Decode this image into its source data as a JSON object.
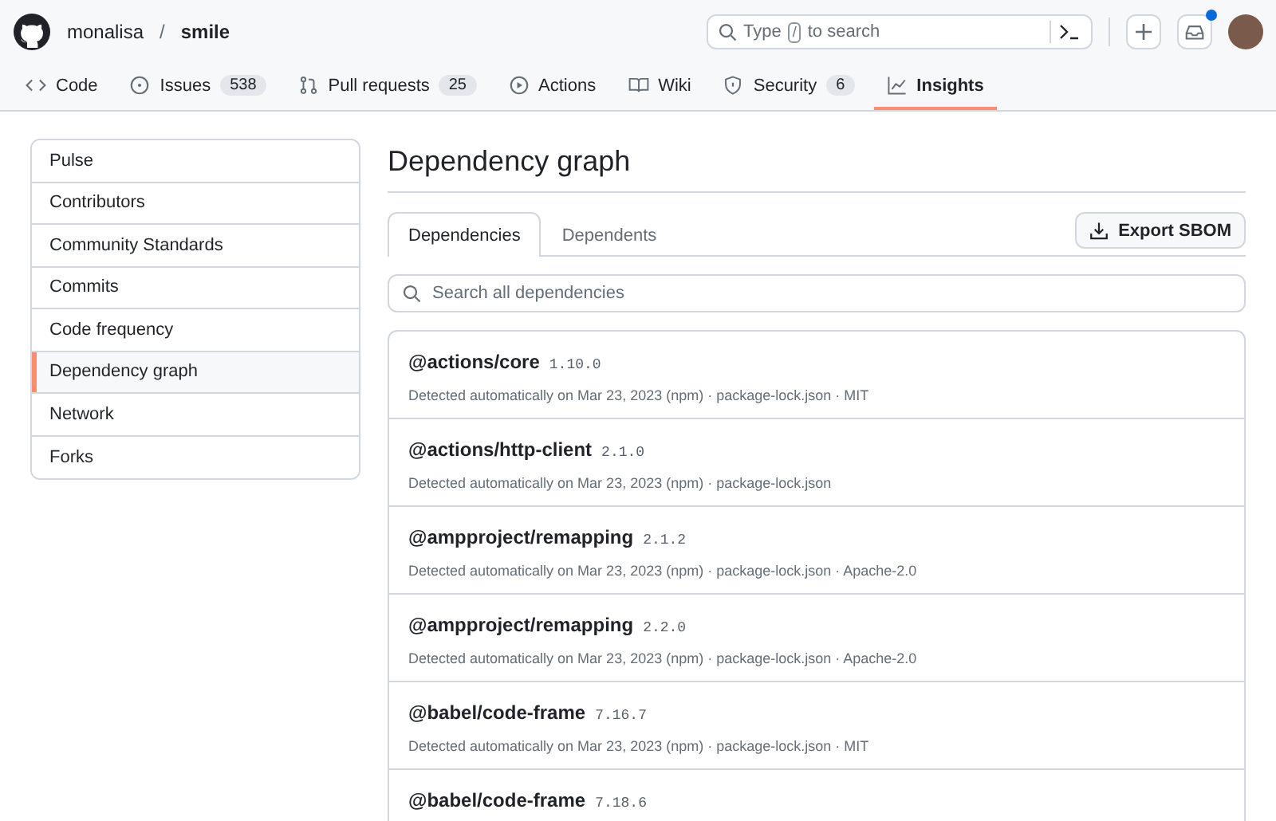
{
  "header": {
    "owner": "monalisa",
    "separator": "/",
    "repo": "smile",
    "search": {
      "before": "Type",
      "key": "/",
      "after": "to search"
    },
    "notification_unread": true
  },
  "repo_nav": [
    {
      "kind": "code",
      "label": "Code",
      "selected": false
    },
    {
      "kind": "issue",
      "label": "Issues",
      "count": "538",
      "selected": false
    },
    {
      "kind": "pull",
      "label": "Pull requests",
      "count": "25",
      "selected": false
    },
    {
      "kind": "play",
      "label": "Actions",
      "selected": false
    },
    {
      "kind": "book",
      "label": "Wiki",
      "selected": false
    },
    {
      "kind": "shield",
      "label": "Security",
      "count": "6",
      "selected": false
    },
    {
      "kind": "graph",
      "label": "Insights",
      "selected": true
    }
  ],
  "sidebar": {
    "items": [
      {
        "label": "Pulse",
        "selected": false
      },
      {
        "label": "Contributors",
        "selected": false
      },
      {
        "label": "Community Standards",
        "selected": false
      },
      {
        "label": "Commits",
        "selected": false
      },
      {
        "label": "Code frequency",
        "selected": false
      },
      {
        "label": "Dependency graph",
        "selected": true
      },
      {
        "label": "Network",
        "selected": false
      },
      {
        "label": "Forks",
        "selected": false
      }
    ]
  },
  "main": {
    "title": "Dependency graph",
    "tabs": [
      {
        "label": "Dependencies",
        "selected": true
      },
      {
        "label": "Dependents",
        "selected": false
      }
    ],
    "export_button": "Export SBOM",
    "search": {
      "placeholder": "Search all dependencies"
    },
    "dependencies": [
      {
        "name": "@actions/core",
        "version": "1.10.0",
        "details": "Detected automatically on Mar 23, 2023 (npm) · package-lock.json · MIT"
      },
      {
        "name": "@actions/http-client",
        "version": "2.1.0",
        "details": "Detected automatically on Mar 23, 2023 (npm) · package-lock.json"
      },
      {
        "name": "@ampproject/remapping",
        "version": "2.1.2",
        "details": "Detected automatically on Mar 23, 2023 (npm) · package-lock.json · Apache-2.0"
      },
      {
        "name": "@ampproject/remapping",
        "version": "2.2.0",
        "details": "Detected automatically on Mar 23, 2023 (npm) · package-lock.json · Apache-2.0"
      },
      {
        "name": "@babel/code-frame",
        "version": "7.16.7",
        "details": "Detected automatically on Mar 23, 2023 (npm) · package-lock.json · MIT"
      },
      {
        "name": "@babel/code-frame",
        "version": "7.18.6"
      }
    ]
  }
}
